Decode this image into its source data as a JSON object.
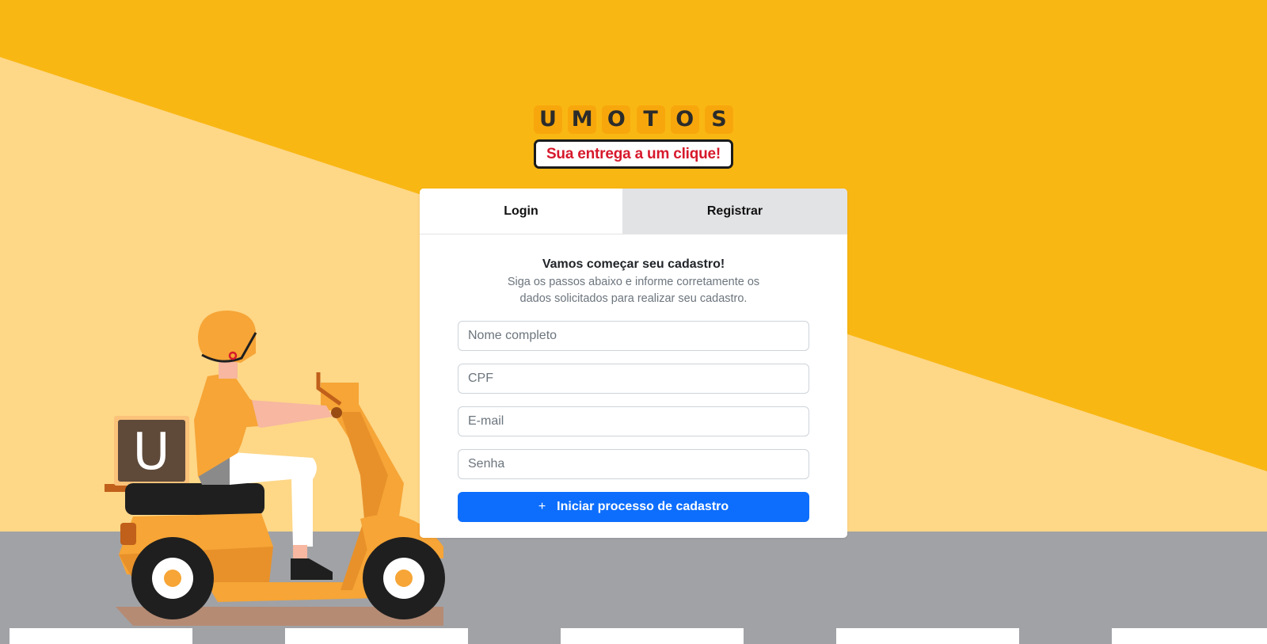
{
  "brand": {
    "letters": [
      "U",
      "M",
      "O",
      "T",
      "O",
      "S"
    ],
    "tagline": "Sua entrega a um clique!",
    "box_letter": "U"
  },
  "tabs": [
    {
      "label": "Login",
      "active": true
    },
    {
      "label": "Registrar",
      "active": false
    }
  ],
  "form": {
    "title": "Vamos começar seu cadastro!",
    "subtitle": "Siga os passos abaixo e informe corretamente os dados solicitados para realizar seu cadastro.",
    "fields": {
      "name": {
        "placeholder": "Nome completo",
        "value": ""
      },
      "cpf": {
        "placeholder": "CPF",
        "value": ""
      },
      "email": {
        "placeholder": "E-mail",
        "value": ""
      },
      "password": {
        "placeholder": "Senha",
        "value": ""
      }
    },
    "submit_icon": "+",
    "submit_label": "Iniciar processo de cadastro"
  },
  "colors": {
    "background_yellow": "#f9b713",
    "light_yellow": "#fed787",
    "road": "#a1a2a6",
    "button_blue": "#0d6efd",
    "tagline_red": "#d7192c"
  },
  "icons": {
    "submit": "plus-icon",
    "illustration": "delivery-scooter-rider"
  }
}
